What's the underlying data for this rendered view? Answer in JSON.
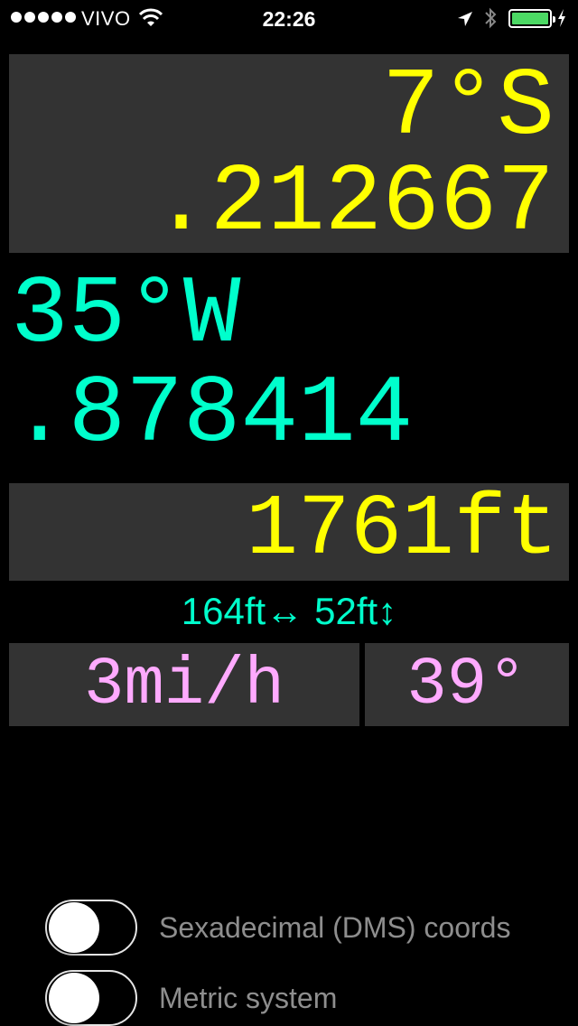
{
  "status_bar": {
    "carrier": "VIVO",
    "time": "22:26",
    "battery_color": "#4cd964"
  },
  "latitude": {
    "degrees": "7°S",
    "fraction": ".212667",
    "color": "#ffff00"
  },
  "longitude": {
    "degrees": "35°W",
    "fraction": ".878414",
    "color": "#00ffcc"
  },
  "altitude": {
    "value": "1761ft",
    "color": "#ffff00"
  },
  "accuracy": {
    "horizontal": "164ft↔",
    "vertical": "52ft↕",
    "color": "#00ffcc"
  },
  "speed": {
    "value": "3mi/h",
    "color": "#ffaaff"
  },
  "heading": {
    "value": "39°",
    "color": "#ffaaff"
  },
  "settings": {
    "dms_label": "Sexadecimal (DMS) coords",
    "dms_enabled": false,
    "metric_label": "Metric system",
    "metric_enabled": false
  },
  "icons": {
    "signal": "signal-dots-icon",
    "wifi": "wifi-icon",
    "location": "location-arrow-icon",
    "bluetooth": "bluetooth-icon",
    "battery": "battery-icon",
    "charging": "charging-bolt-icon"
  }
}
